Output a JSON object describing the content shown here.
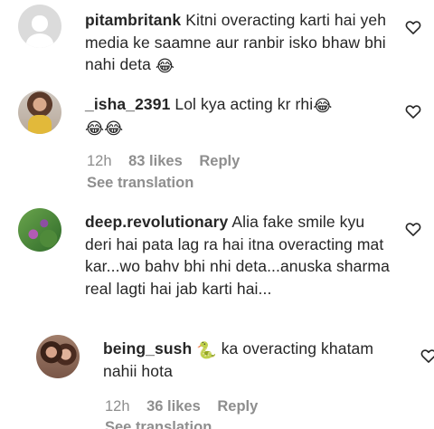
{
  "comments": [
    {
      "username": "pitambritank",
      "text": "Kitni overacting karti hai yeh media ke saamne aur ranbir isko bhaw bhi nahi deta",
      "emoji": "😂"
    },
    {
      "username": "_isha_2391",
      "text": "Lol kya acting kr rhi",
      "emoji": "😂",
      "emoji_line2": "😂😂",
      "time": "12h",
      "likes": "83 likes",
      "reply": "Reply",
      "see_translation": "See translation"
    },
    {
      "username": "deep.revolutionary",
      "text": "Alia fake smile kyu deri hai pata lag ra hai itna overacting mat kar...wo bahv bhi nhi deta...anuska sharma real lagti hai jab karti hai...",
      "reply_item": {
        "username": "being_sush",
        "emoji": "🐍",
        "text": "ka overacting khatam nahii hota",
        "time": "12h",
        "likes": "36 likes",
        "reply": "Reply",
        "see_translation": "See translation"
      }
    }
  ]
}
